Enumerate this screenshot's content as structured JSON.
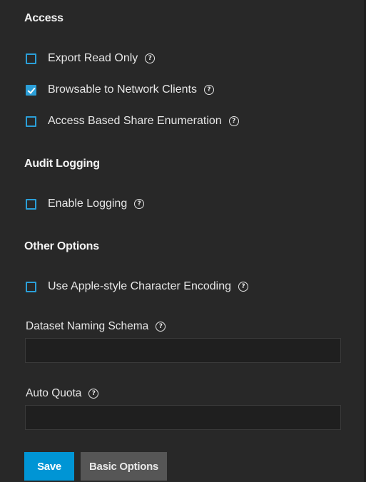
{
  "sections": {
    "access": {
      "title": "Access",
      "options": [
        {
          "label": "Export Read Only",
          "checked": false
        },
        {
          "label": "Browsable to Network Clients",
          "checked": true
        },
        {
          "label": "Access Based Share Enumeration",
          "checked": false
        }
      ]
    },
    "audit": {
      "title": "Audit Logging",
      "options": [
        {
          "label": "Enable Logging",
          "checked": false
        }
      ]
    },
    "other": {
      "title": "Other Options",
      "options": [
        {
          "label": "Use Apple-style Character Encoding",
          "checked": false
        }
      ]
    }
  },
  "fields": {
    "dataset_naming_schema": {
      "label": "Dataset Naming Schema",
      "value": ""
    },
    "auto_quota": {
      "label": "Auto Quota",
      "value": ""
    }
  },
  "help_glyph": "?",
  "buttons": {
    "save": "Save",
    "basic_options": "Basic Options"
  },
  "colors": {
    "background": "#282828",
    "accent": "#0095d5",
    "checkbox": "#2b9fd8",
    "input_bg": "#1f1f1f",
    "secondary_button": "#565656"
  }
}
